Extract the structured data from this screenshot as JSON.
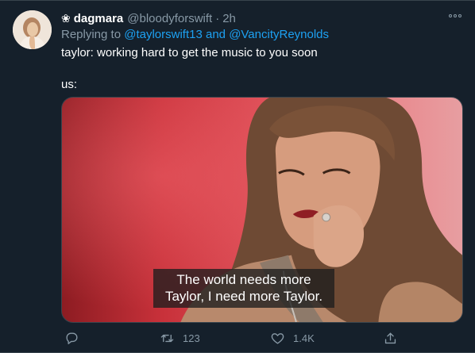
{
  "tweet": {
    "author": {
      "prefix_icon": "❀",
      "display_name": "dagmara",
      "handle": "@bloodyforswift",
      "separator": "·",
      "timestamp": "2h"
    },
    "reply": {
      "prefix": "Replying to ",
      "mention_1": "@taylorswift13",
      "joiner": " and ",
      "mention_2": "@VancityReynolds"
    },
    "text_lines": {
      "line_1": "taylor: working hard to get the music to you soon",
      "line_2": "us:"
    },
    "media": {
      "caption_line_1": "The world needs more",
      "caption_line_2": "Taylor, I need more Taylor."
    },
    "actions": {
      "reply_icon": "reply-icon",
      "retweet_icon": "retweet-icon",
      "retweet_count": "123",
      "like_icon": "heart-icon",
      "like_count": "1.4K",
      "share_icon": "share-icon"
    },
    "colors": {
      "background": "#15202b",
      "muted": "#8899a6",
      "link": "#1da1f2",
      "border": "#38444d"
    }
  }
}
